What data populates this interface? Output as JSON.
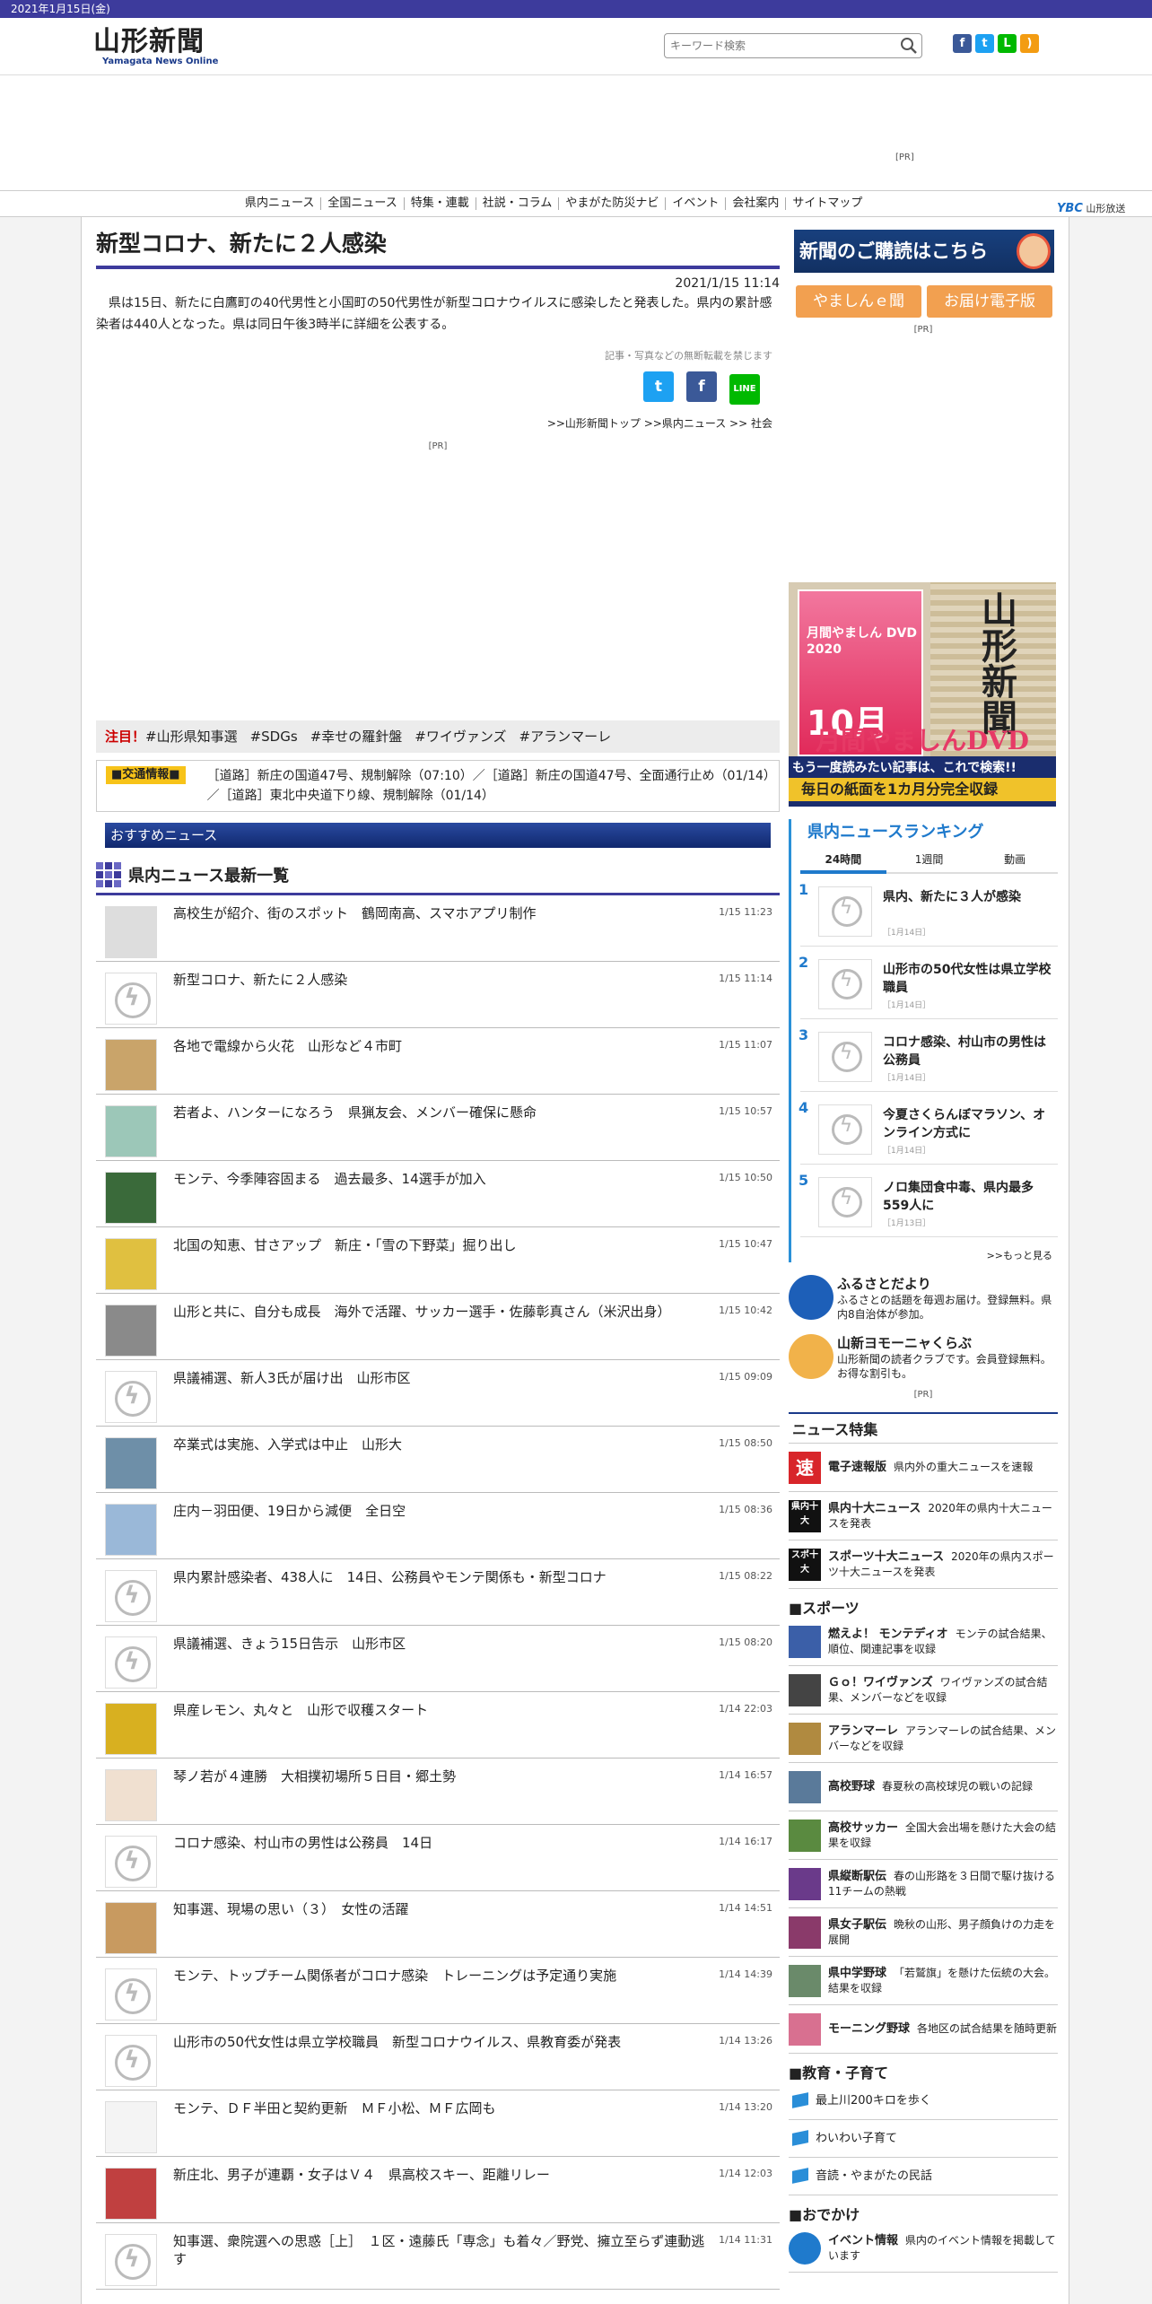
{
  "topbar": {
    "date": "2021年1月15日(金)"
  },
  "header": {
    "logo_ja": "山形新聞",
    "logo_en": "Yamagata News Online",
    "search_placeholder": "キーワード検索"
  },
  "ad_pr": "[PR]",
  "nav": {
    "items": [
      "県内ニュース",
      "全国ニュース",
      "特集・連載",
      "社説・コラム",
      "やまがた防災ナビ",
      "イベント",
      "会社案内",
      "サイトマップ"
    ],
    "ybc": "山形放送",
    "ybc_mark": "YBC"
  },
  "article": {
    "title": "新型コロナ、新たに２人感染",
    "date": "2021/1/15 11:14",
    "body": "県は15日、新たに白鷹町の40代男性と小国町の50代男性が新型コロナウイルスに感染したと発表した。県内の累計感染者は440人となった。県は同日午後3時半に詳細を公表する。",
    "no_repro": "記事・写真などの無断転載を禁じます",
    "breadcrumb": ">>山形新聞トップ >>県内ニュース >> 社会",
    "pr": "[PR]"
  },
  "attention": {
    "label": "注目！",
    "tags": [
      "#山形県知事選",
      "#SDGs",
      "#幸せの羅針盤",
      "#ワイヴァンズ",
      "#アランマーレ"
    ]
  },
  "traffic": {
    "label": "■交通情報■",
    "text": "［道路］新庄の国道47号、規制解除（07:10）／［道路］新庄の国道47号、全面通行止め（01/14）／［道路］東北中央道下り線、規制解除（01/14）"
  },
  "osusume": "おすすめニュース",
  "list_title": "県内ニュース最新一覧",
  "news": [
    {
      "title": "高校生が紹介、街のスポット　鶴岡南高、スマホアプリ制作",
      "time": "1/15 11:23",
      "img": "qr"
    },
    {
      "title": "新型コロナ、新たに２人感染",
      "time": "1/15 11:14",
      "img": "none"
    },
    {
      "title": "各地で電線から火花　山形など４市町",
      "time": "1/15 11:07",
      "img": "photo"
    },
    {
      "title": "若者よ、ハンターになろう　県猟友会、メンバー確保に懸命",
      "time": "1/15 10:57",
      "img": "chart"
    },
    {
      "title": "モンテ、今季陣容固まる　過去最多、14選手が加入",
      "time": "1/15 10:50",
      "img": "team"
    },
    {
      "title": "北国の知恵、甘さアップ　新庄・「雪の下野菜」掘り出し",
      "time": "1/15 10:47",
      "img": "veg"
    },
    {
      "title": "山形と共に、自分も成長　海外で活躍、サッカー選手・佐藤彰真さん（米沢出身）",
      "time": "1/15 10:42",
      "img": "person"
    },
    {
      "title": "県議補選、新人3氏が届け出　山形市区",
      "time": "1/15 09:09",
      "img": "none"
    },
    {
      "title": "卒業式は実施、入学式は中止　山形大",
      "time": "1/15 08:50",
      "img": "bldg"
    },
    {
      "title": "庄内－羽田便、19日から減便　全日空",
      "time": "1/15 08:36",
      "img": "plane"
    },
    {
      "title": "県内累計感染者、438人に　14日、公務員やモンテ関係も・新型コロナ",
      "time": "1/15 08:22",
      "img": "none"
    },
    {
      "title": "県議補選、きょう15日告示　山形市区",
      "time": "1/15 08:20",
      "img": "none"
    },
    {
      "title": "県産レモン、丸々と　山形で収穫スタート",
      "time": "1/14 22:03",
      "img": "lemon"
    },
    {
      "title": "琴ノ若が４連勝　大相撲初場所５日目・郷土勢",
      "time": "1/14 16:57",
      "img": "sumo"
    },
    {
      "title": "コロナ感染、村山市の男性は公務員　14日",
      "time": "1/14 16:17",
      "img": "none"
    },
    {
      "title": "知事選、現場の思い（３）　女性の活躍",
      "time": "1/14 14:51",
      "img": "woman"
    },
    {
      "title": "モンテ、トップチーム関係者がコロナ感染　トレーニングは予定通り実施",
      "time": "1/14 14:39",
      "img": "none"
    },
    {
      "title": "山形市の50代女性は県立学校職員　新型コロナウイルス、県教育委が発表",
      "time": "1/14 13:26",
      "img": "none"
    },
    {
      "title": "モンテ、ＤＦ半田と契約更新　ＭＦ小松、ＭＦ広岡も",
      "time": "1/14 13:20",
      "img": "emblem"
    },
    {
      "title": "新庄北、男子が連覇・女子はＶ４　県高校スキー、距離リレー",
      "time": "1/14 12:03",
      "img": "ski"
    },
    {
      "title": "知事選、衆院選への思惑［上］　１区・遠藤氏「専念」も着々／野党、擁立至らず連動逃す",
      "time": "1/14 11:31",
      "img": "none"
    }
  ],
  "side": {
    "subscribe": "新聞のご購読はこちら",
    "btn1": "やましんｅ聞",
    "btn2": "お届け電子版",
    "pr": "[PR]",
    "dvd": {
      "cover_title": "月間やましん DVD 2020",
      "cover_month": "10月",
      "newspaper": "山形新聞",
      "big": "月間やましんDVD",
      "line1": "もう一度読みたい記事は、これで検索!!",
      "line2": "毎日の紙面を1カ月分完全収録"
    },
    "ranking": {
      "title": "県内ニュースランキング",
      "tabs": [
        "24時間",
        "1週間",
        "動画"
      ],
      "items": [
        {
          "n": "1",
          "title": "県内、新たに３人が感染",
          "date": "［1月14日］"
        },
        {
          "n": "2",
          "title": "山形市の50代女性は県立学校職員",
          "date": "［1月14日］"
        },
        {
          "n": "3",
          "title": "コロナ感染、村山市の男性は公務員",
          "date": "［1月14日］"
        },
        {
          "n": "4",
          "title": "今夏さくらんぼマラソン、オンライン方式に",
          "date": "［1月14日］"
        },
        {
          "n": "5",
          "title": "ノロ集団食中毒、県内最多559人に",
          "date": "［1月13日］"
        }
      ],
      "more": ">>もっと見る"
    },
    "furusato": {
      "title": "ふるさとだより",
      "text": "ふるさとの話題を毎週お届け。登録無料。県内8自治体が参加。"
    },
    "yomo": {
      "title": "山新ヨモーニャくらぶ",
      "text": "山形新聞の読者クラブです。会員登録無料。お得な割引も。"
    },
    "pr2": "[PR]",
    "tokushu_title": "ニュース特集",
    "tokushu": [
      {
        "icon": "速",
        "name": "電子速報版",
        "text": "県内外の重大ニュースを速報"
      },
      {
        "icon": "県内十大",
        "name": "県内十大ニュース",
        "text": "2020年の県内十大ニュースを発表"
      },
      {
        "icon": "スポ十大",
        "name": "スポーツ十大ニュース",
        "text": "2020年の県内スポーツ十大ニュースを発表"
      }
    ],
    "sports_title": "■スポーツ",
    "sports": [
      {
        "name": "燃えよ！ モンテディオ",
        "text": "モンテの試合結果、順位、関連記事を収録"
      },
      {
        "name": "Ｇｏ！ワイヴァンズ",
        "text": "ワイヴァンズの試合結果、メンバーなどを収録"
      },
      {
        "name": "アランマーレ",
        "text": "アランマーレの試合結果、メンバーなどを収録"
      },
      {
        "name": "高校野球",
        "text": "春夏秋の高校球児の戦いの記録"
      },
      {
        "name": "高校サッカー",
        "text": "全国大会出場を懸けた大会の結果を収録"
      },
      {
        "name": "県縦断駅伝",
        "text": "春の山形路を３日間で駆け抜ける11チームの熱戦"
      },
      {
        "name": "県女子駅伝",
        "text": "晩秋の山形、男子顔負けの力走を展開"
      },
      {
        "name": "県中学野球",
        "text": "「若鷲旗」を懸けた伝統の大会。結果を収録"
      },
      {
        "name": "モーニング野球",
        "text": "各地区の試合結果を随時更新"
      }
    ],
    "edu_title": "■教育・子育て",
    "edu": [
      "最上川200キロを歩く",
      "わいわい子育て",
      "音読・やまがたの民話"
    ],
    "odekake_title": "■おでかけ",
    "odekake": [
      {
        "name": "イベント情報",
        "text": "県内のイベント情報を掲載しています"
      }
    ]
  },
  "colors": {
    "brand": "#3d3b9c",
    "accent": "#1f7acc",
    "alert": "#cc0000"
  }
}
